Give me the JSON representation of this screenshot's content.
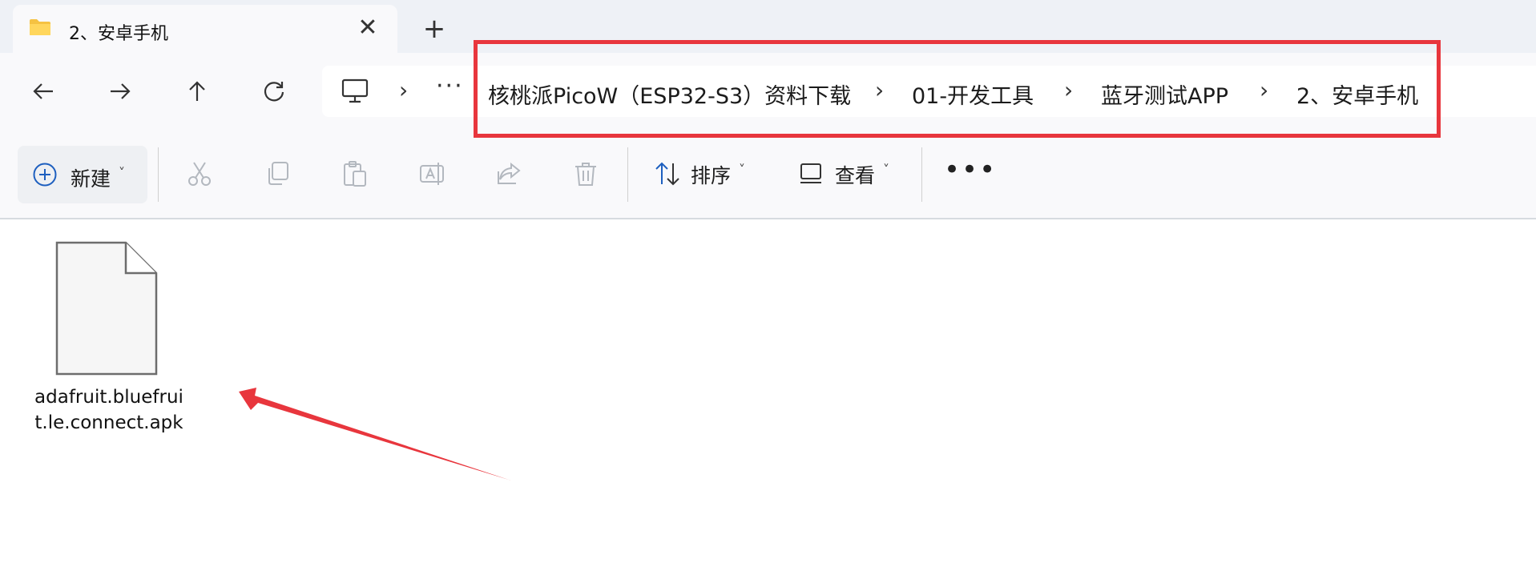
{
  "tab": {
    "title": "2、安卓手机",
    "close_glyph": "✕",
    "new_tab_glyph": "+"
  },
  "nav": {
    "back_icon": "arrow-left-icon",
    "forward_icon": "arrow-right-icon",
    "up_icon": "arrow-up-icon",
    "refresh_icon": "refresh-icon",
    "more_glyph": "···"
  },
  "address": {
    "separator": "›",
    "crumbs": [
      "核桃派PicoW（ESP32-S3）资料下载",
      "01-开发工具",
      "蓝牙测试APP",
      "2、安卓手机"
    ]
  },
  "toolbar": {
    "new_label": "新建",
    "sort_label": "排序",
    "view_label": "查看",
    "more_glyph": "•••",
    "dropdown_glyph": "˅"
  },
  "files": [
    {
      "name": "adafruit.bluefruit.le.connect.apk",
      "icon": "generic-file-icon"
    }
  ],
  "annotation": {
    "highlight_color": "#e8363d",
    "arrow_color": "#e8363d"
  }
}
